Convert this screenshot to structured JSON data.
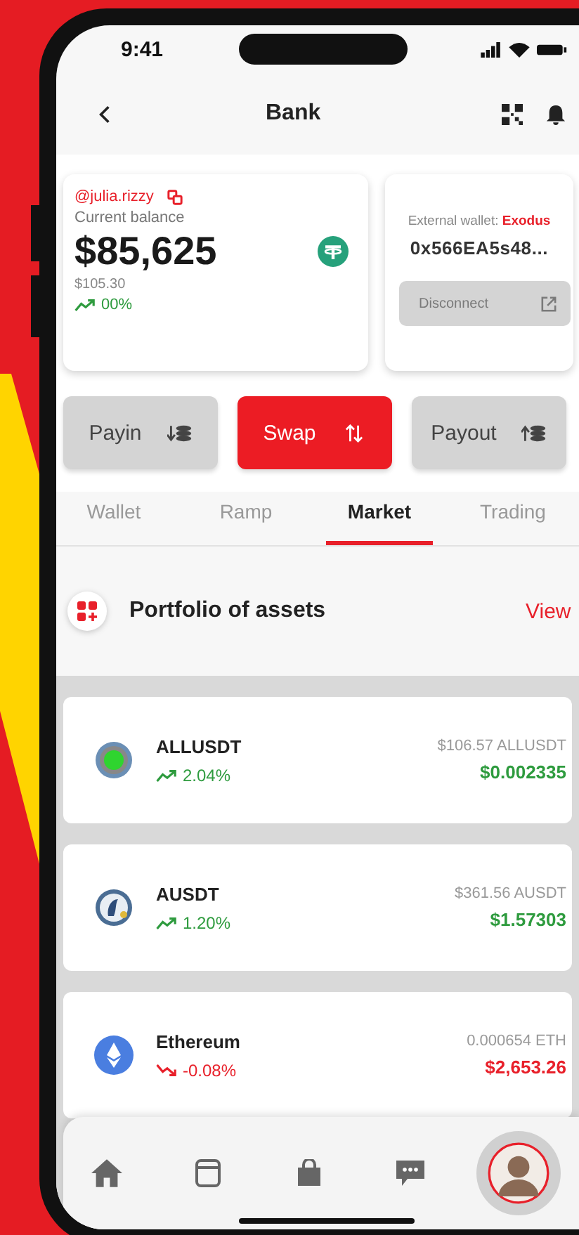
{
  "status_bar": {
    "time": "9:41"
  },
  "header": {
    "title": "Bank"
  },
  "balance_card": {
    "handle": "@julia.rizzy",
    "label": "Current balance",
    "amount": "$85,625",
    "sub_amount": "$105.30",
    "change": "00%",
    "rising": true
  },
  "wallet_card": {
    "label": "External wallet:",
    "wallet_name": "Exodus",
    "address": "0x566EA5s48...",
    "button": {
      "label": "Disconnect",
      "disabled": true
    }
  },
  "actions": [
    {
      "label": "Payin",
      "kind": "payin",
      "selected": false
    },
    {
      "label": "Swap",
      "kind": "swap",
      "selected": true
    },
    {
      "label": "Payout",
      "kind": "payout",
      "selected": false
    }
  ],
  "tabs": [
    {
      "label": "Wallet",
      "selected": false
    },
    {
      "label": "Ramp",
      "selected": false
    },
    {
      "label": "Market",
      "selected": true
    },
    {
      "label": "Trading",
      "selected": false
    }
  ],
  "portfolio": {
    "title": "Portfolio of assets",
    "link": "View"
  },
  "assets": [
    {
      "name": "ALLUSDT",
      "kind": "lime",
      "change": "2.04%",
      "rising": true,
      "amount": "$106.57 ALLUSDT",
      "value": "$0.002335"
    },
    {
      "name": "AUSDT",
      "kind": "globe",
      "change": "1.20%",
      "rising": true,
      "amount": "$361.56 AUSDT",
      "value": "$1.57303"
    },
    {
      "name": "Ethereum",
      "kind": "ethereum",
      "change": "-0.08%",
      "rising": false,
      "amount": "0.000654 ETH",
      "value": "$2,653.26"
    }
  ]
}
